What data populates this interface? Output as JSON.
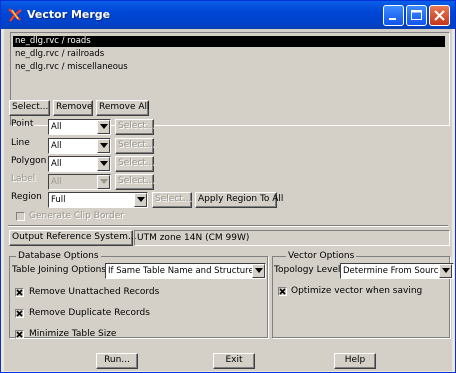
{
  "window": {
    "title": "Vector Merge"
  },
  "layers": [
    {
      "label": "ne_dlg.rvc / roads",
      "selected": true
    },
    {
      "label": "ne_dlg.rvc / railroads",
      "selected": false
    },
    {
      "label": "ne_dlg.rvc / miscellaneous",
      "selected": false
    }
  ],
  "toolbar": {
    "select": "Select...",
    "remove": "Remove",
    "remove_all": "Remove All"
  },
  "filters": {
    "point": {
      "label": "Point",
      "value": "All",
      "select": "Select..."
    },
    "line": {
      "label": "Line",
      "value": "All",
      "select": "Select..."
    },
    "polygon": {
      "label": "Polygon",
      "value": "All",
      "select": "Select..."
    },
    "label": {
      "label": "Label",
      "value": "All",
      "select": "Select..."
    },
    "region": {
      "label": "Region",
      "value": "Full",
      "select": "Select...",
      "apply_all": "Apply Region To All"
    }
  },
  "generate_clip_border": {
    "label": "Generate Clip Border",
    "checked": false
  },
  "output_ref": {
    "button": "Output Reference System...",
    "value": "UTM zone 14N (CM 99W)"
  },
  "database_options": {
    "title": "Database Options",
    "table_joining_label": "Table Joining Options",
    "table_joining_value": "If Same Table Name and Structure",
    "remove_unattached": {
      "label": "Remove Unattached Records",
      "checked": true
    },
    "remove_duplicate": {
      "label": "Remove Duplicate Records",
      "checked": true
    },
    "minimize_table": {
      "label": "Minimize Table Size",
      "checked": true
    }
  },
  "vector_options": {
    "title": "Vector Options",
    "topology_label": "Topology Level",
    "topology_value": "Determine From Source",
    "optimize": {
      "label": "Optimize vector when saving",
      "checked": true
    }
  },
  "footer": {
    "run": "Run...",
    "exit": "Exit",
    "help": "Help"
  },
  "colors": {
    "title_bar": "#0046d5",
    "dialog_bg": "#d4d0c8",
    "selection": "#000000"
  }
}
